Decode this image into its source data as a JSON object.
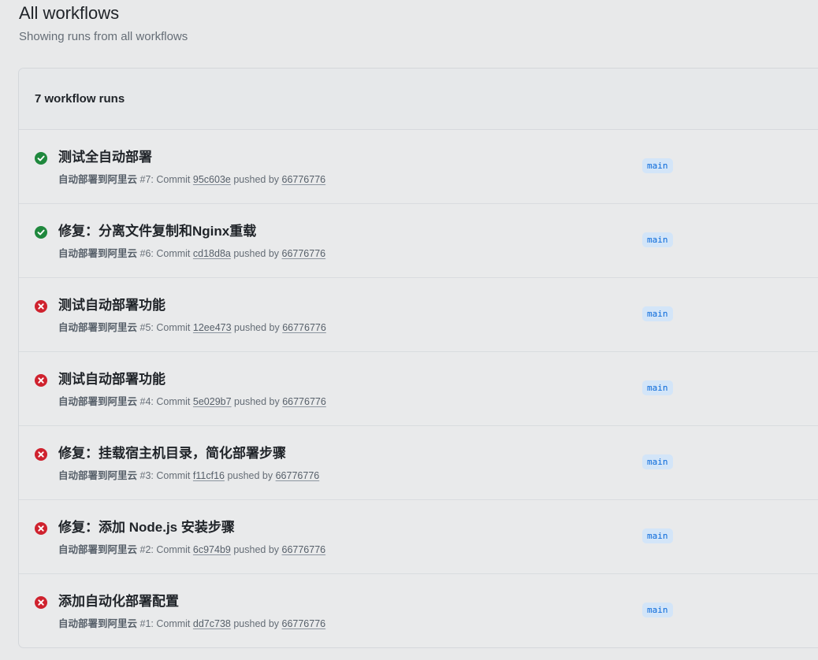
{
  "page": {
    "title": "All workflows",
    "subtitle": "Showing runs from all workflows"
  },
  "runs_header": {
    "count_label": "7 workflow runs"
  },
  "colors": {
    "success": "#1f883d",
    "failure": "#cf222e",
    "link": "#0969da"
  },
  "runs": [
    {
      "status": "success",
      "status_icon": "check-circle-icon",
      "title": "测试全自动部署",
      "workflow": "自动部署到阿里云",
      "run_number": "#7",
      "commit_prefix": ": Commit ",
      "commit": "95c603e",
      "pushed_by": " pushed by ",
      "actor": "66776776",
      "branch": "main"
    },
    {
      "status": "success",
      "status_icon": "check-circle-icon",
      "title": "修复：分离文件复制和Nginx重载",
      "workflow": "自动部署到阿里云",
      "run_number": "#6",
      "commit_prefix": ": Commit ",
      "commit": "cd18d8a",
      "pushed_by": " pushed by ",
      "actor": "66776776",
      "branch": "main"
    },
    {
      "status": "failure",
      "status_icon": "x-circle-icon",
      "title": "测试自动部署功能",
      "workflow": "自动部署到阿里云",
      "run_number": "#5",
      "commit_prefix": ": Commit ",
      "commit": "12ee473",
      "pushed_by": " pushed by ",
      "actor": "66776776",
      "branch": "main"
    },
    {
      "status": "failure",
      "status_icon": "x-circle-icon",
      "title": "测试自动部署功能",
      "workflow": "自动部署到阿里云",
      "run_number": "#4",
      "commit_prefix": ": Commit ",
      "commit": "5e029b7",
      "pushed_by": " pushed by ",
      "actor": "66776776",
      "branch": "main"
    },
    {
      "status": "failure",
      "status_icon": "x-circle-icon",
      "title": "修复：挂载宿主机目录，简化部署步骤",
      "workflow": "自动部署到阿里云",
      "run_number": "#3",
      "commit_prefix": ": Commit ",
      "commit": "f11cf16",
      "pushed_by": " pushed by ",
      "actor": "66776776",
      "branch": "main"
    },
    {
      "status": "failure",
      "status_icon": "x-circle-icon",
      "title": "修复：添加 Node.js 安装步骤",
      "workflow": "自动部署到阿里云",
      "run_number": "#2",
      "commit_prefix": ": Commit ",
      "commit": "6c974b9",
      "pushed_by": " pushed by ",
      "actor": "66776776",
      "branch": "main"
    },
    {
      "status": "failure",
      "status_icon": "x-circle-icon",
      "title": "添加自动化部署配置",
      "workflow": "自动部署到阿里云",
      "run_number": "#1",
      "commit_prefix": ": Commit ",
      "commit": "dd7c738",
      "pushed_by": " pushed by ",
      "actor": "66776776",
      "branch": "main"
    }
  ]
}
